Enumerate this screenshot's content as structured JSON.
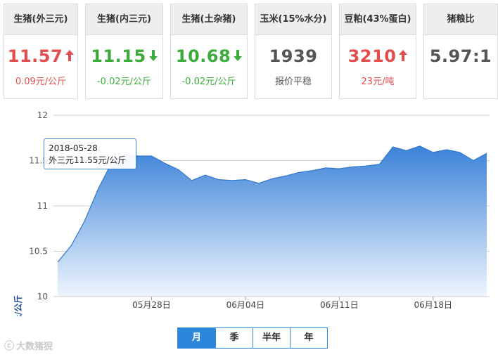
{
  "cards": [
    {
      "title": "生猪(外三元)",
      "price": "11.57",
      "direction": "up",
      "change": "0.09元/公斤"
    },
    {
      "title": "生猪(内三元)",
      "price": "11.15",
      "direction": "down",
      "change": "-0.02元/公斤"
    },
    {
      "title": "生猪(土杂猪)",
      "price": "10.68",
      "direction": "down",
      "change": "-0.02元/公斤"
    },
    {
      "title": "玉米(15%水分)",
      "price": "1939",
      "direction": "flat",
      "change": "报价平稳"
    },
    {
      "title": "豆粕(43%蛋白)",
      "price": "3210",
      "direction": "up",
      "change": "23元/吨"
    },
    {
      "title": "猪粮比",
      "price": "5.97:1",
      "direction": "none",
      "change": ""
    }
  ],
  "colors": {
    "up": "#e24d4d",
    "down": "#3cab3c",
    "accent": "#2c86d9",
    "area_top": "#3b82d8",
    "area_bottom": "#eef5fd"
  },
  "chart_data": {
    "type": "area",
    "ylabel": "元/公斤",
    "ylim": [
      10,
      12
    ],
    "yticks": [
      "10",
      "10.5",
      "11",
      "11.5",
      "12"
    ],
    "x_tick_labels": [
      "05月28日",
      "06月04日",
      "06月11日",
      "06月18日"
    ],
    "x_tick_dates": [
      "2018-05-28",
      "2018-06-04",
      "2018-06-11",
      "2018-06-18"
    ],
    "series": [
      {
        "x": [
          "2018-05-21",
          "2018-05-22",
          "2018-05-23",
          "2018-05-24",
          "2018-05-25",
          "2018-05-26",
          "2018-05-27",
          "2018-05-28",
          "2018-05-29",
          "2018-05-30",
          "2018-05-31",
          "2018-06-01",
          "2018-06-02",
          "2018-06-03",
          "2018-06-04",
          "2018-06-05",
          "2018-06-06",
          "2018-06-07",
          "2018-06-08",
          "2018-06-09",
          "2018-06-10",
          "2018-06-11",
          "2018-06-12",
          "2018-06-13",
          "2018-06-14",
          "2018-06-15",
          "2018-06-16",
          "2018-06-17",
          "2018-06-18",
          "2018-06-19",
          "2018-06-20",
          "2018-06-21",
          "2018-06-22"
        ],
        "values": [
          10.38,
          10.56,
          10.83,
          11.18,
          11.47,
          11.57,
          11.55,
          11.55,
          11.47,
          11.4,
          11.28,
          11.34,
          11.29,
          11.28,
          11.29,
          11.25,
          11.3,
          11.33,
          11.37,
          11.39,
          11.42,
          11.41,
          11.43,
          11.44,
          11.46,
          11.65,
          11.61,
          11.66,
          11.59,
          11.62,
          11.59,
          11.5,
          11.58
        ]
      }
    ],
    "grid": true,
    "tooltip": {
      "date": "2018-05-28",
      "text": "外三元11.55元/公斤"
    }
  },
  "tabs": [
    {
      "label": "月",
      "active": true
    },
    {
      "label": "季",
      "active": false
    },
    {
      "label": "半年",
      "active": false
    },
    {
      "label": "年",
      "active": false
    }
  ],
  "watermark": "大数猪猊"
}
